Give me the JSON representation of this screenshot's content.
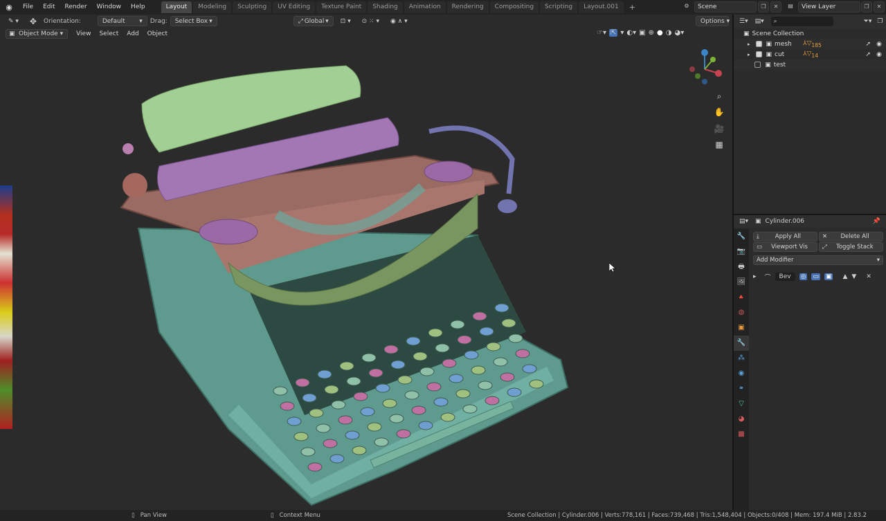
{
  "menu": [
    "File",
    "Edit",
    "Render",
    "Window",
    "Help"
  ],
  "workspaces": [
    {
      "label": "Layout",
      "active": true
    },
    {
      "label": "Modeling",
      "active": false
    },
    {
      "label": "Sculpting",
      "active": false
    },
    {
      "label": "UV Editing",
      "active": false
    },
    {
      "label": "Texture Paint",
      "active": false
    },
    {
      "label": "Shading",
      "active": false
    },
    {
      "label": "Animation",
      "active": false
    },
    {
      "label": "Rendering",
      "active": false
    },
    {
      "label": "Compositing",
      "active": false
    },
    {
      "label": "Scripting",
      "active": false
    },
    {
      "label": "Layout.001",
      "active": false
    }
  ],
  "scene": {
    "name": "Scene",
    "view_layer": "View Layer"
  },
  "tool_header": {
    "orientation_label": "Orientation:",
    "orientation_value": "Default",
    "drag_label": "Drag:",
    "drag_value": "Select Box",
    "transform_orientation": "Global",
    "options": "Options"
  },
  "viewport": {
    "mode": "Object Mode",
    "menus": [
      "View",
      "Select",
      "Add",
      "Object"
    ]
  },
  "outliner": {
    "root": "Scene Collection",
    "items": [
      {
        "name": "mesh",
        "checked": true,
        "badge": "185"
      },
      {
        "name": "cut",
        "checked": true,
        "badge": "14"
      },
      {
        "name": "test",
        "checked": false,
        "badge": ""
      }
    ]
  },
  "properties": {
    "object_name": "Cylinder.006",
    "apply_all": "Apply All",
    "delete_all": "Delete All",
    "viewport_vis": "Viewport Vis",
    "toggle_stack": "Toggle Stack",
    "add_modifier": "Add Modifier",
    "modifier_name": "Bev"
  },
  "status": {
    "pan_view": "Pan View",
    "context_menu": "Context Menu",
    "stats": "Scene Collection | Cylinder.006 | Verts:778,161 | Faces:739,468 | Tris:1,548,404 | Objects:0/408 | Mem: 197.4 MiB | 2.83.2"
  },
  "colors": {
    "accent": "#4772b3",
    "active_tab": "#464646",
    "panel": "#2b2b2b"
  }
}
